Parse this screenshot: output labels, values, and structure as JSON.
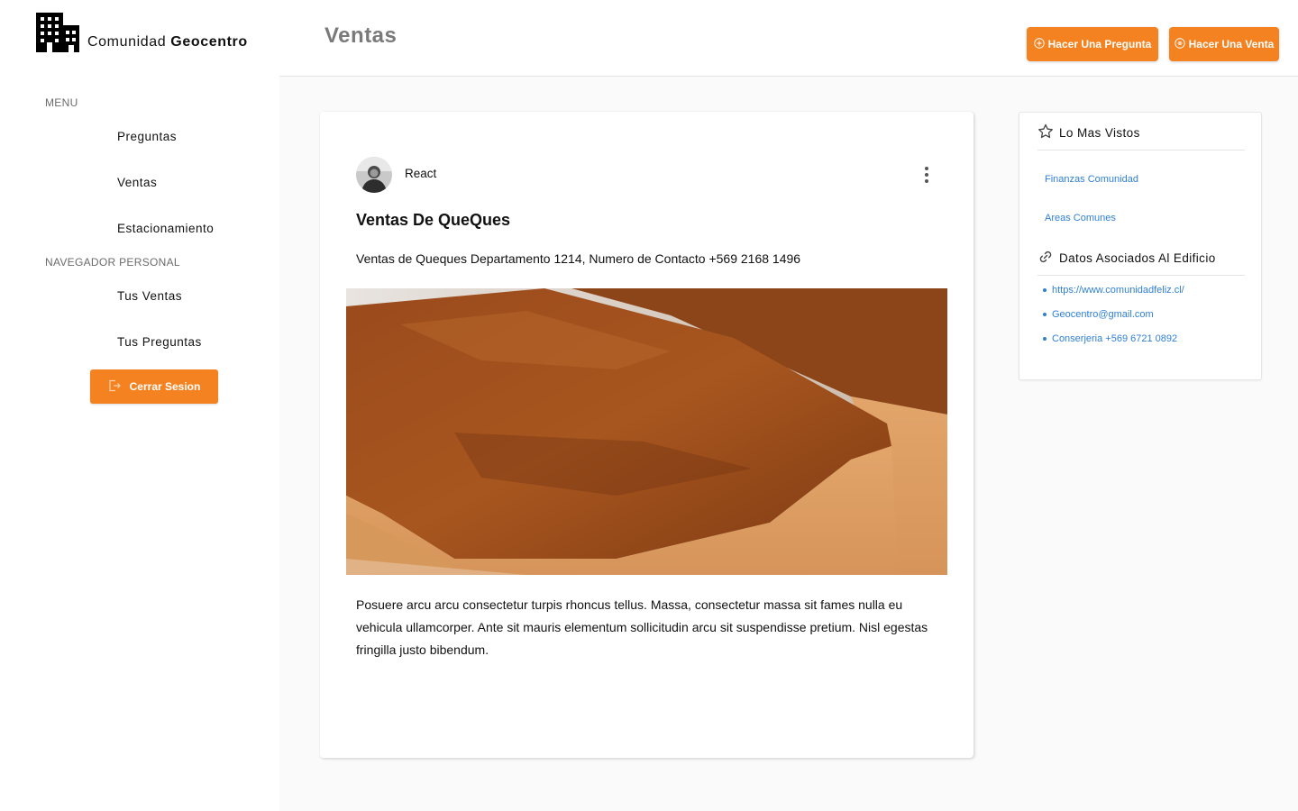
{
  "brand": {
    "name_prefix": "Comunidad",
    "name_bold": "Geocentro",
    "logo_icon": "building-icon"
  },
  "sidebar": {
    "menu_label": "MENU",
    "menu_items": [
      {
        "label": "Preguntas"
      },
      {
        "label": "Ventas"
      },
      {
        "label": "Estacionamiento"
      }
    ],
    "personal_label": "NAVEGADOR PERSONAL",
    "personal_items": [
      {
        "label": "Tus Ventas"
      },
      {
        "label": "Tus Preguntas"
      }
    ],
    "logout_label": "Cerrar Sesion",
    "logout_icon": "logout-icon"
  },
  "header": {
    "title": "Ventas",
    "ask_button": "Hacer Una Pregunta",
    "ask_icon": "plus-circle-icon",
    "sell_button": "Hacer Una Venta",
    "sell_icon": "dollar-circle-icon"
  },
  "post": {
    "author": "React",
    "title": "Ventas De QueQues",
    "subtitle": "Ventas de Queques Departamento 1214, Numero de Contacto +569 2168 1496",
    "body": "Posuere arcu arcu consectetur turpis rhoncus tellus. Massa, consectetur massa sit fames nulla eu vehicula ullamcorper. Ante sit mauris elementum sollicitudin arcu sit suspendisse pretium. Nisl egestas fringilla justo bibendum.",
    "image_alt": "cake-photo"
  },
  "side_panel": {
    "most_viewed_title": "Lo Mas Vistos",
    "most_viewed_icon": "star-icon",
    "most_viewed": [
      {
        "label": "Finanzas Comunidad"
      },
      {
        "label": "Areas Comunes"
      }
    ],
    "building_title": "Datos Asociados Al Edificio",
    "building_icon": "link-icon",
    "building_links": [
      {
        "label": "https://www.comunidadfeliz.cl/"
      },
      {
        "label": "Geocentro@gmail.com"
      },
      {
        "label": "Conserjeria +569 6721 0892"
      }
    ]
  },
  "colors": {
    "accent": "#f58220",
    "link": "#2f7fd6",
    "title_gray": "#7a7a7a"
  }
}
